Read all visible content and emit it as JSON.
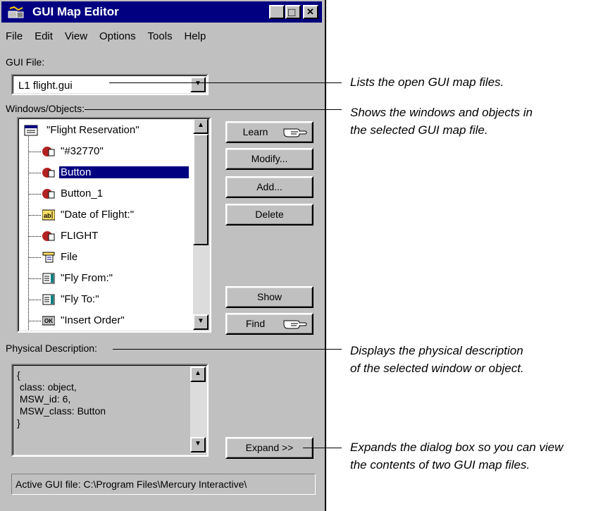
{
  "window": {
    "title": "GUI Map Editor",
    "controls": {
      "minimize": "_",
      "maximize": "□",
      "close": "✕"
    }
  },
  "menu": [
    "File",
    "Edit",
    "View",
    "Options",
    "Tools",
    "Help"
  ],
  "gui_file": {
    "label": "GUI File:",
    "selected": "L1  flight.gui"
  },
  "windows_objects": {
    "label": "Windows/Objects:",
    "items": [
      {
        "text": "\"Flight Reservation\"",
        "icon": "window-icon",
        "selected": false
      },
      {
        "text": "\"#32770\"",
        "icon": "object-icon",
        "selected": false
      },
      {
        "text": "Button",
        "icon": "object-icon",
        "selected": true
      },
      {
        "text": "Button_1",
        "icon": "object-icon",
        "selected": false
      },
      {
        "text": "\"Date of Flight:\"",
        "icon": "edit-field-icon",
        "selected": false
      },
      {
        "text": "FLIGHT",
        "icon": "object-icon",
        "selected": false
      },
      {
        "text": "File",
        "icon": "menu-icon",
        "selected": false
      },
      {
        "text": "\"Fly From:\"",
        "icon": "list-icon",
        "selected": false
      },
      {
        "text": "\"Fly To:\"",
        "icon": "list-icon",
        "selected": false
      },
      {
        "text": "\"Insert Order\"",
        "icon": "push-button-icon",
        "selected": false
      }
    ]
  },
  "buttons": {
    "learn": "Learn",
    "modify": "Modify...",
    "add": "Add...",
    "delete": "Delete",
    "show": "Show",
    "find": "Find",
    "expand": "Expand >>"
  },
  "physical_description": {
    "label": "Physical Description:",
    "text": "{\n class: object,\n MSW_id: 6,\n MSW_class: Button\n}"
  },
  "status": "Active GUI file: C:\\Program Files\\Mercury Interactive\\",
  "annotations": {
    "gui_file": "Lists the open GUI map files.",
    "windows_objects_1": "Shows the windows and objects in",
    "windows_objects_2": "the selected GUI map file.",
    "physical_1": "Displays the physical description",
    "physical_2": "of the selected window or object.",
    "expand_1": "Expands the dialog box so you can view",
    "expand_2": "the contents of two GUI map files."
  },
  "colors": {
    "titlebar": "#000080",
    "face": "#c0c0c0",
    "selection": "#000080"
  }
}
